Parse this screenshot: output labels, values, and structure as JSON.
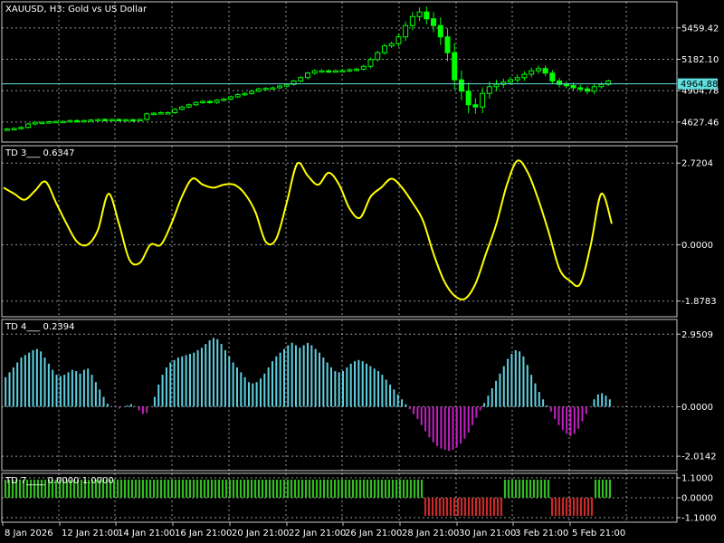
{
  "colors": {
    "background": "#000000",
    "grid": "#c8c8c8",
    "frame": "#c8c8c8",
    "text": "#ffffff",
    "price_line": "#00ff00",
    "current_price": "#5fe0e0",
    "td3_line": "#ffff00",
    "td4_positive": "#5fd0e0",
    "td4_negative": "#c020c0",
    "td7_positive": "#33bb22",
    "td7_negative": "#c82a2a"
  },
  "chart_data": [
    {
      "type": "candlestick",
      "title": "XAUUSD, H3:  Gold vs US Dollar",
      "yticks": [
        4627.46,
        4904.78,
        5182.1,
        5459.42
      ],
      "ytick_labels": [
        "4627.46",
        "4904.78",
        "5182.10",
        "5459.42"
      ],
      "ylim": [
        4450,
        5690
      ],
      "current_price": 4964.88,
      "current_price_label": "4964.88",
      "close": [
        4565,
        4570,
        4580,
        4610,
        4625,
        4625,
        4630,
        4632,
        4633,
        4640,
        4638,
        4640,
        4645,
        4650,
        4648,
        4650,
        4645,
        4648,
        4646,
        4650,
        4700,
        4705,
        4710,
        4710,
        4740,
        4760,
        4780,
        4800,
        4810,
        4800,
        4820,
        4830,
        4850,
        4870,
        4880,
        4900,
        4920,
        4925,
        4930,
        4945,
        4960,
        4990,
        5020,
        5060,
        5080,
        5080,
        5075,
        5080,
        5082,
        5090,
        5095,
        5120,
        5180,
        5240,
        5300,
        5320,
        5380,
        5480,
        5560,
        5600,
        5540,
        5480,
        5380,
        5240,
        5000,
        4900,
        4780,
        4760,
        4880,
        4940,
        4960,
        4980,
        5000,
        5020,
        5050,
        5080,
        5100,
        5060,
        4990,
        4960,
        4950,
        4930,
        4920,
        4900,
        4940,
        4960,
        4990
      ],
      "range": [
        25,
        25,
        25,
        25,
        25,
        20,
        20,
        20,
        20,
        20,
        20,
        20,
        20,
        20,
        20,
        20,
        20,
        20,
        20,
        20,
        25,
        25,
        25,
        25,
        25,
        25,
        25,
        25,
        25,
        25,
        25,
        25,
        25,
        25,
        25,
        25,
        25,
        25,
        25,
        25,
        25,
        25,
        30,
        30,
        30,
        30,
        30,
        30,
        30,
        30,
        30,
        30,
        40,
        40,
        40,
        40,
        60,
        80,
        90,
        90,
        110,
        130,
        160,
        170,
        190,
        180,
        170,
        130,
        120,
        100,
        90,
        70,
        60,
        60,
        60,
        60,
        60,
        60,
        60,
        60,
        60,
        60,
        60,
        60,
        60,
        40,
        30
      ]
    },
    {
      "type": "line",
      "title": "TD 3___  0.6347",
      "yticks": [
        2.7204,
        0.0,
        -1.8783
      ],
      "ytick_labels": [
        "2.7204",
        "0.0000",
        "-1.8783"
      ],
      "ylim": [
        -2.4,
        3.3
      ],
      "values": [
        1.9,
        1.7,
        1.5,
        1.8,
        2.1,
        1.4,
        0.7,
        0.1,
        0.0,
        0.5,
        1.7,
        0.7,
        -0.5,
        -0.6,
        0.0,
        0.0,
        0.7,
        1.6,
        2.2,
        2.0,
        1.9,
        2.0,
        2.0,
        1.7,
        1.1,
        0.1,
        0.2,
        1.4,
        2.7,
        2.3,
        2.0,
        2.4,
        2.0,
        1.2,
        0.9,
        1.6,
        1.9,
        2.2,
        1.9,
        1.4,
        0.8,
        -0.3,
        -1.2,
        -1.7,
        -1.8,
        -1.3,
        -0.3,
        0.7,
        2.0,
        2.8,
        2.4,
        1.5,
        0.4,
        -0.8,
        -1.2,
        -1.3,
        0.0,
        1.7,
        0.7
      ]
    },
    {
      "type": "bar",
      "title": "TD 4___  0.2394",
      "yticks": [
        2.9509,
        0.0,
        -2.0142
      ],
      "ytick_labels": [
        "2.9509",
        "0.0000",
        "-2.0142"
      ],
      "ylim": [
        -2.6,
        3.55
      ],
      "values": [
        1.2,
        1.4,
        1.6,
        1.8,
        2.0,
        2.1,
        2.2,
        2.3,
        2.35,
        2.25,
        2.0,
        1.75,
        1.5,
        1.3,
        1.25,
        1.3,
        1.4,
        1.5,
        1.45,
        1.35,
        1.5,
        1.55,
        1.3,
        1.0,
        0.7,
        0.4,
        0.12,
        0.0,
        0.0,
        -0.08,
        0.0,
        0.05,
        0.1,
        0.02,
        -0.15,
        -0.3,
        -0.25,
        0.0,
        0.4,
        0.9,
        1.3,
        1.6,
        1.8,
        1.9,
        2.0,
        2.05,
        2.1,
        2.15,
        2.2,
        2.3,
        2.4,
        2.55,
        2.7,
        2.8,
        2.75,
        2.55,
        2.3,
        2.05,
        1.8,
        1.6,
        1.4,
        1.2,
        1.0,
        0.95,
        1.0,
        1.15,
        1.35,
        1.6,
        1.85,
        2.05,
        2.2,
        2.35,
        2.5,
        2.6,
        2.5,
        2.4,
        2.5,
        2.6,
        2.5,
        2.35,
        2.2,
        2.0,
        1.8,
        1.6,
        1.45,
        1.4,
        1.45,
        1.6,
        1.75,
        1.85,
        1.9,
        1.85,
        1.75,
        1.65,
        1.55,
        1.45,
        1.3,
        1.1,
        0.9,
        0.7,
        0.5,
        0.3,
        0.1,
        -0.1,
        -0.3,
        -0.5,
        -0.75,
        -1.0,
        -1.25,
        -1.45,
        -1.6,
        -1.7,
        -1.75,
        -1.8,
        -1.75,
        -1.65,
        -1.5,
        -1.3,
        -1.05,
        -0.75,
        -0.45,
        -0.15,
        0.15,
        0.45,
        0.75,
        1.05,
        1.35,
        1.65,
        1.95,
        2.15,
        2.3,
        2.25,
        2.05,
        1.7,
        1.3,
        0.95,
        0.6,
        0.3,
        0.05,
        -0.2,
        -0.5,
        -0.75,
        -0.95,
        -1.1,
        -1.2,
        -1.1,
        -0.9,
        -0.6,
        -0.3,
        0.0,
        0.3,
        0.5,
        0.55,
        0.45,
        0.3
      ]
    },
    {
      "type": "bar",
      "title": "TD 7____  0.0000  1.0000",
      "yticks": [
        1.1,
        0.0,
        -1.1
      ],
      "ytick_labels": [
        "1.1000",
        "0.0000",
        "-1.1000"
      ],
      "ylim": [
        -1.35,
        1.35
      ],
      "segments": [
        {
          "value": 1,
          "count": 116
        },
        {
          "value": -1,
          "count": 22
        },
        {
          "value": 1,
          "count": 13
        },
        {
          "value": -1,
          "count": 12
        },
        {
          "value": 1,
          "count": 5
        }
      ]
    }
  ],
  "x_axis": {
    "labels": [
      "8 Jan 2026",
      "12 Jan 21:00",
      "14 Jan 21:00",
      "16 Jan 21:00",
      "20 Jan 21:00",
      "22 Jan 21:00",
      "26 Jan 21:00",
      "28 Jan 21:00",
      "30 Jan 21:00",
      "3 Feb 21:00",
      "5 Feb 21:00"
    ]
  }
}
